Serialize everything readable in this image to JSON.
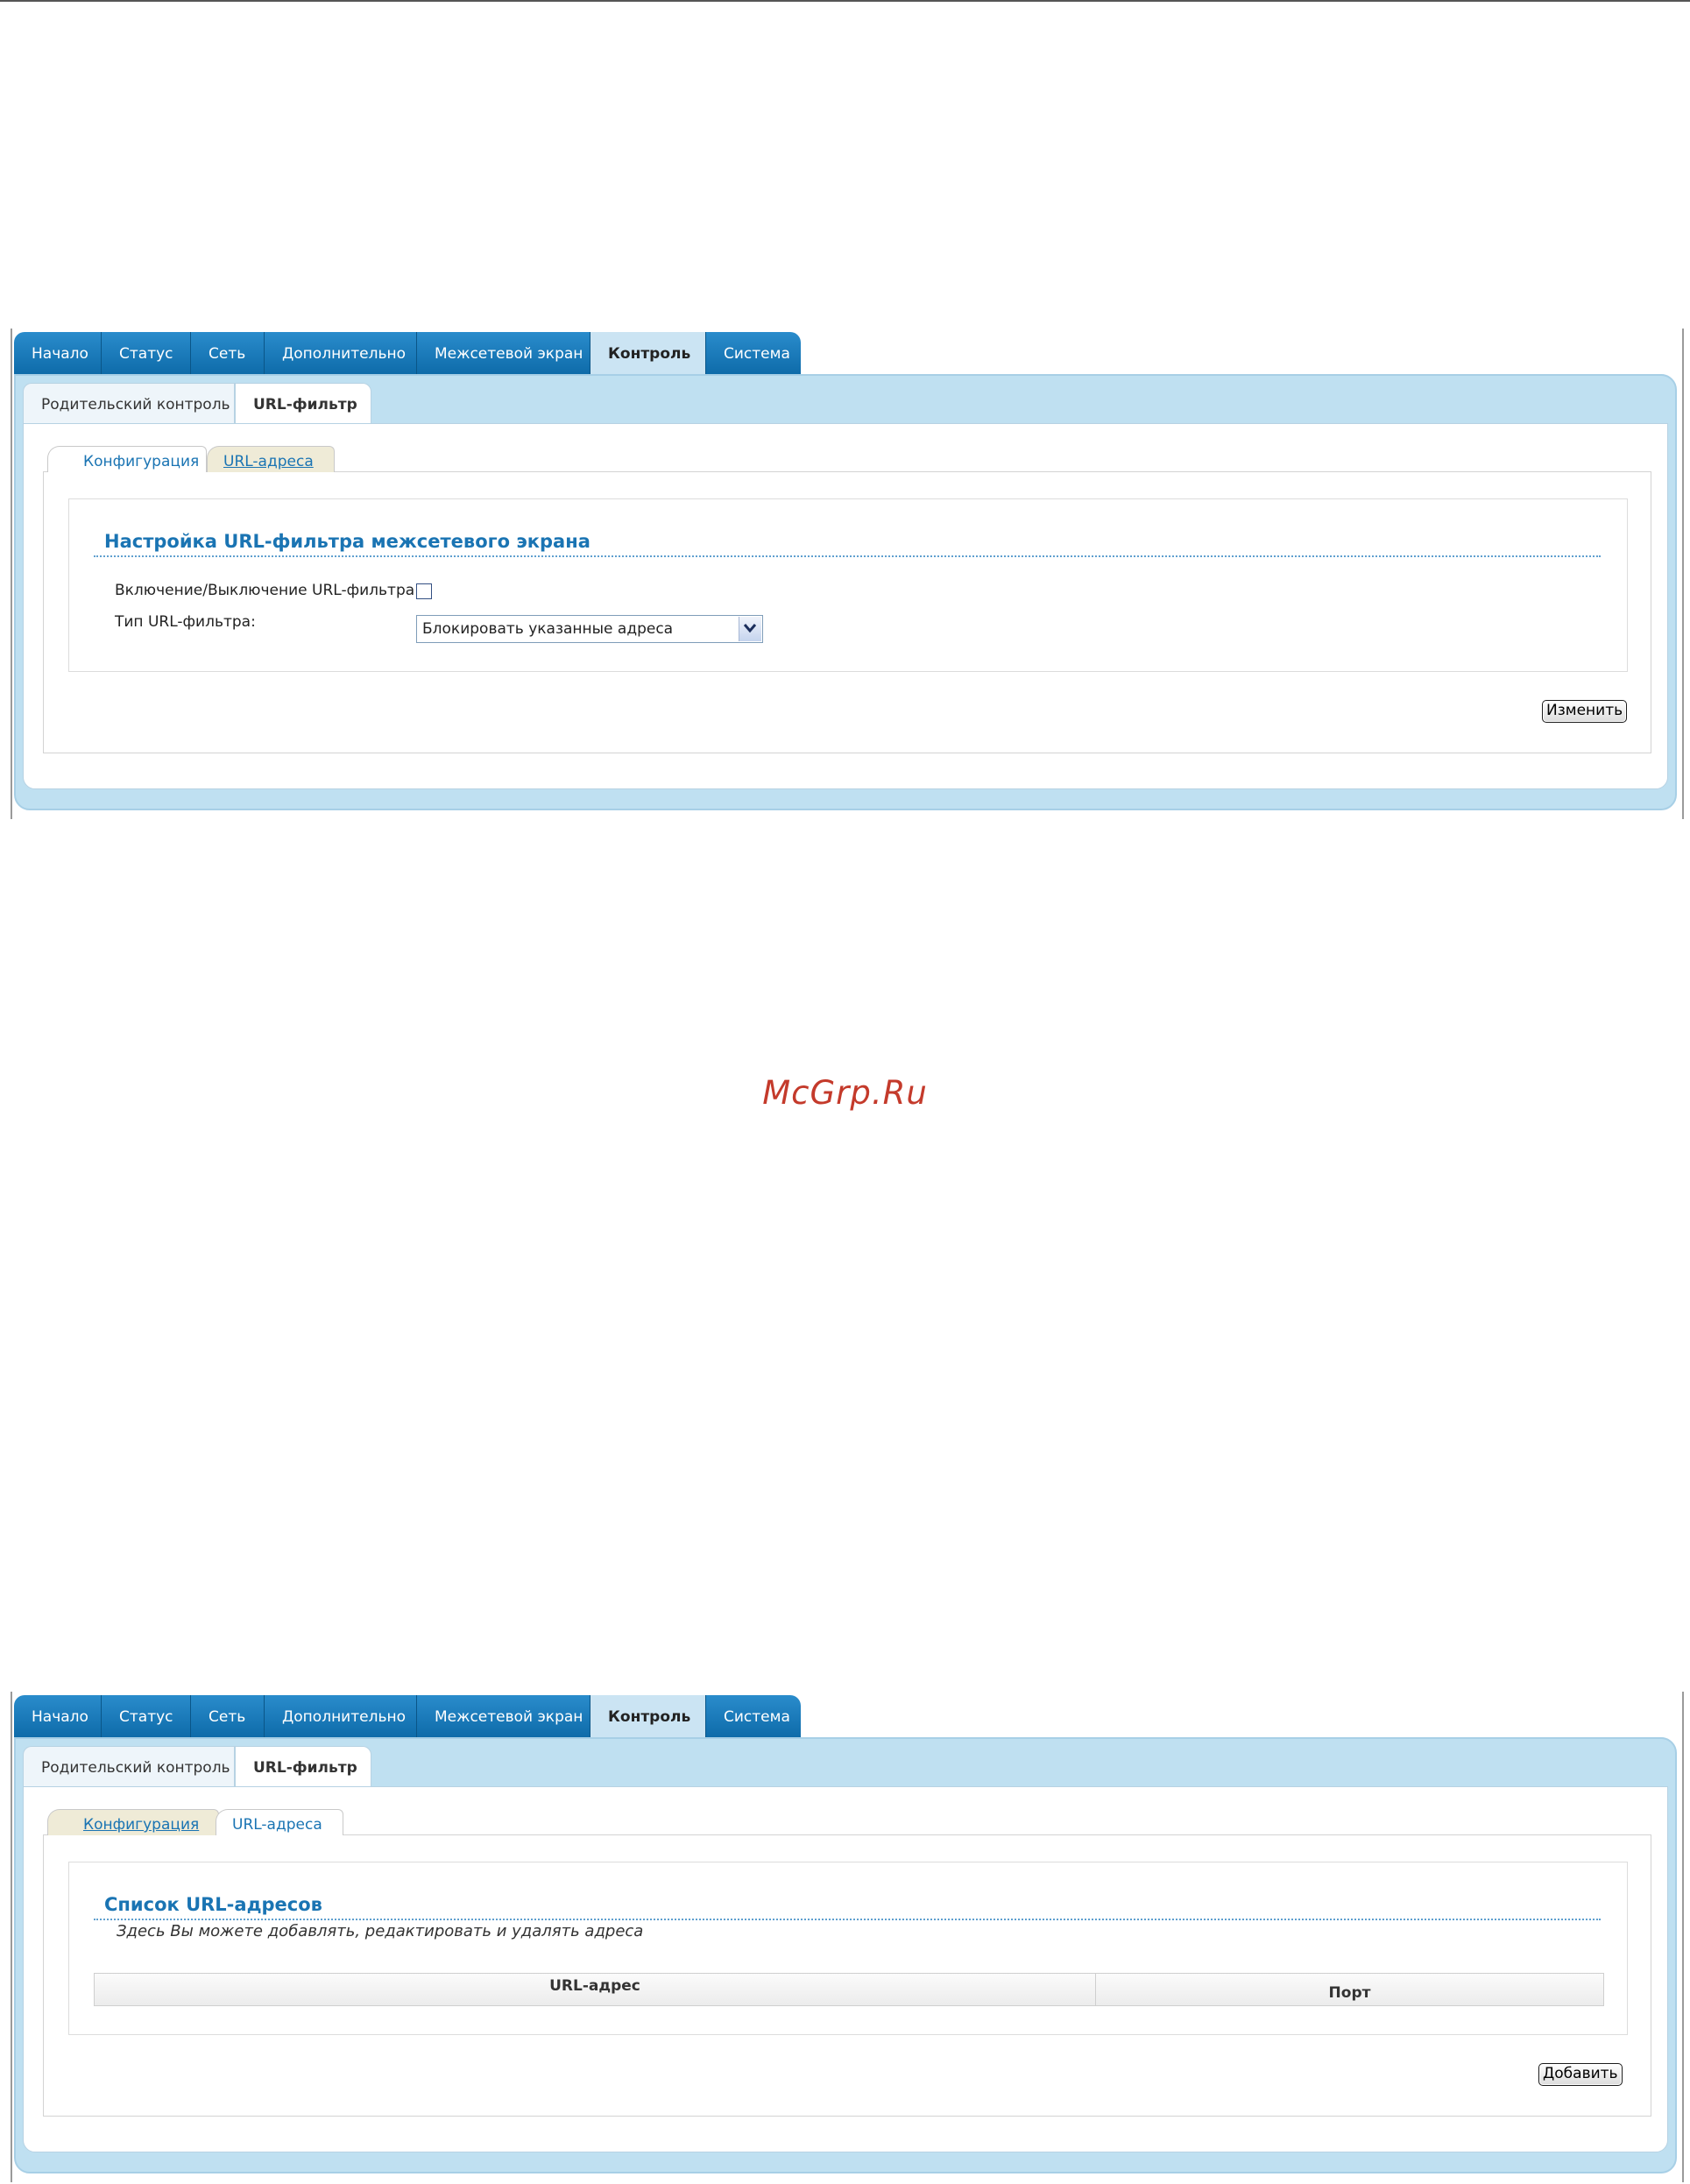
{
  "main_tabs": [
    "Начало",
    "Статус",
    "Сеть",
    "Дополнительно",
    "Межсетевой экран",
    "Контроль",
    "Система"
  ],
  "active_main_tab": "Контроль",
  "sub_tabs": [
    "Родительский контроль",
    "URL-фильтр"
  ],
  "active_sub_tab": "URL-фильтр",
  "config_screen": {
    "tabs": [
      "Конфигурация",
      "URL-адреса"
    ],
    "active_tab": "Конфигурация",
    "section_title": "Настройка URL-фильтра межсетевого экрана",
    "enable_label": "Включение/Выключение URL-фильтра:",
    "enable_checked": false,
    "type_label": "Тип URL-фильтра:",
    "type_value": "Блокировать указанные адреса",
    "change_button": "Изменить"
  },
  "list_screen": {
    "tabs": [
      "Конфигурация",
      "URL-адреса"
    ],
    "active_tab": "URL-адреса",
    "section_title": "Список URL-адресов",
    "description": "Здесь Вы можете добавлять, редактировать и удалять адреса",
    "columns": [
      "URL-адрес",
      "Порт"
    ],
    "add_button": "Добавить"
  },
  "watermark": "McGrp.Ru",
  "colors": {
    "nav_blue": "#1677b8",
    "panel_blue": "#bfe0f1",
    "title_blue": "#1a74b3",
    "watermark_red": "#c43a2b"
  }
}
